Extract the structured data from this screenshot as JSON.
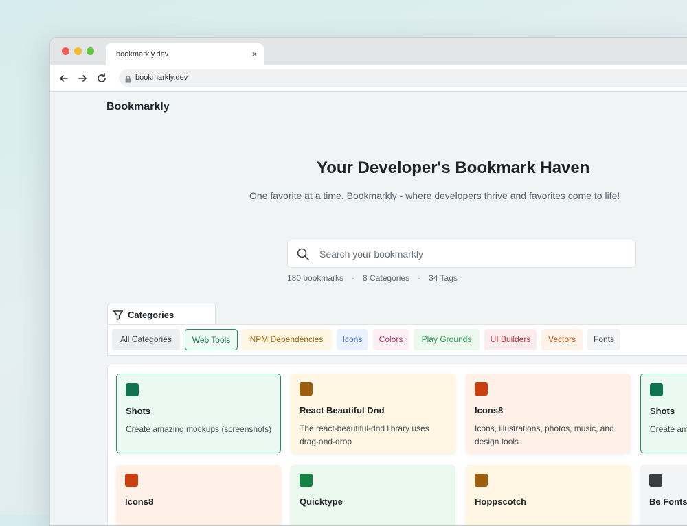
{
  "browser": {
    "tab_title": "bookmarkly.dev",
    "tab_close": "×",
    "url": "bookmarkly.dev"
  },
  "page": {
    "brand": "Bookmarkly",
    "hero_title": "Your Developer's Bookmark Haven",
    "hero_subtitle": "One favorite at a time. Bookmarkly - where developers thrive and favorites come to life!",
    "search_placeholder": "Search your bookmarkly",
    "stats": {
      "bookmarks": "180 bookmarks",
      "categories": "8 Categories",
      "tags": "34 Tags",
      "separator": "·"
    },
    "categories_label": "Categories"
  },
  "chips": [
    {
      "label": "All Categories",
      "bg": "#eceeef",
      "fg": "#3a3f44"
    },
    {
      "label": "Web Tools",
      "bg": "#ecfaf3",
      "fg": "#1f7a57",
      "selected": true
    },
    {
      "label": "NPM Dependencies",
      "bg": "#fff7e4",
      "fg": "#a46c12"
    },
    {
      "label": "Icons",
      "bg": "#eaf1ff",
      "fg": "#3d68d8"
    },
    {
      "label": "Colors",
      "bg": "#fdeef3",
      "fg": "#c23a6c"
    },
    {
      "label": "Play Grounds",
      "bg": "#eaf8ee",
      "fg": "#2b9a55"
    },
    {
      "label": "UI Builders",
      "bg": "#fdecee",
      "fg": "#c3303f"
    },
    {
      "label": "Vectors",
      "bg": "#fff2e8",
      "fg": "#c9581b"
    },
    {
      "label": "Fonts",
      "bg": "#f3f4f5",
      "fg": "#444a50"
    }
  ],
  "cards": [
    {
      "title": "Shots",
      "desc": "Create amazing mockups (screenshots)",
      "bg": "#eafaf2",
      "icon": "#10744f",
      "selected": true
    },
    {
      "title": "React Beautiful Dnd",
      "desc": "The react-beautiful-dnd library uses drag-and-drop",
      "bg": "#fff7e4",
      "icon": "#9c5e0c"
    },
    {
      "title": "Icons8",
      "desc": "Icons, illustrations, photos, music, and design tools",
      "bg": "#fff1e8",
      "icon": "#cb3f0e"
    },
    {
      "title": "Shots",
      "desc": "Create amazing mockups (screenshots)",
      "bg": "#eafaf2",
      "icon": "#10744f",
      "selected": true
    },
    {
      "title": "Icons8",
      "desc": "",
      "bg": "#fff1e8",
      "icon": "#cb3f0e"
    },
    {
      "title": "Quicktype",
      "desc": "",
      "bg": "#eaf8ee",
      "icon": "#158243"
    },
    {
      "title": "Hoppscotch",
      "desc": "",
      "bg": "#fff7e4",
      "icon": "#9c5e0c"
    },
    {
      "title": "Be Fonts",
      "desc": "",
      "bg": "#f3f4f5",
      "icon": "#3b3d3f"
    }
  ],
  "colors": {
    "accent": "#2e8a66",
    "page_bg": "#f1f4f5"
  }
}
